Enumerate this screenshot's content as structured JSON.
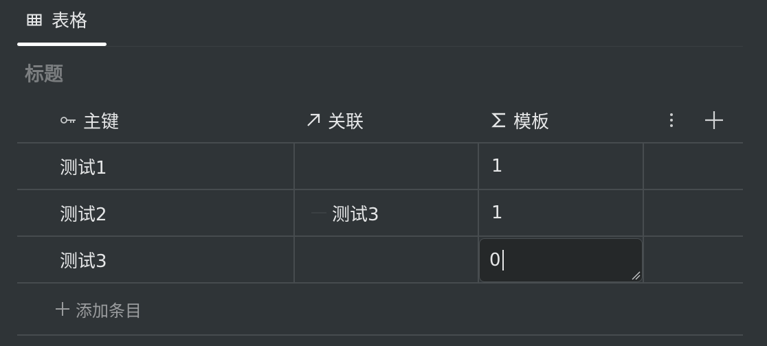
{
  "view_tab": {
    "label": "表格",
    "icon": "table-icon"
  },
  "title": "标题",
  "columns": [
    {
      "label": "主键",
      "icon": "key-icon"
    },
    {
      "label": "关联",
      "icon": "arrow-up-right-icon"
    },
    {
      "label": "模板",
      "icon": "sigma-icon"
    }
  ],
  "header_actions": {
    "more_icon": "more-vertical-icon",
    "add_icon": "plus-icon"
  },
  "rows": [
    {
      "name": "测试1",
      "relation": "",
      "value": "1"
    },
    {
      "name": "测试2",
      "relation": "测试3",
      "value": "1"
    },
    {
      "name": "测试3",
      "relation": "",
      "value": "0"
    }
  ],
  "add_entry_label": "添加条目",
  "colors": {
    "background": "#2f3437",
    "text": "#e6e7e8",
    "muted": "#7b7e80",
    "grid": "#474c4f",
    "editor_bg": "#252829"
  }
}
